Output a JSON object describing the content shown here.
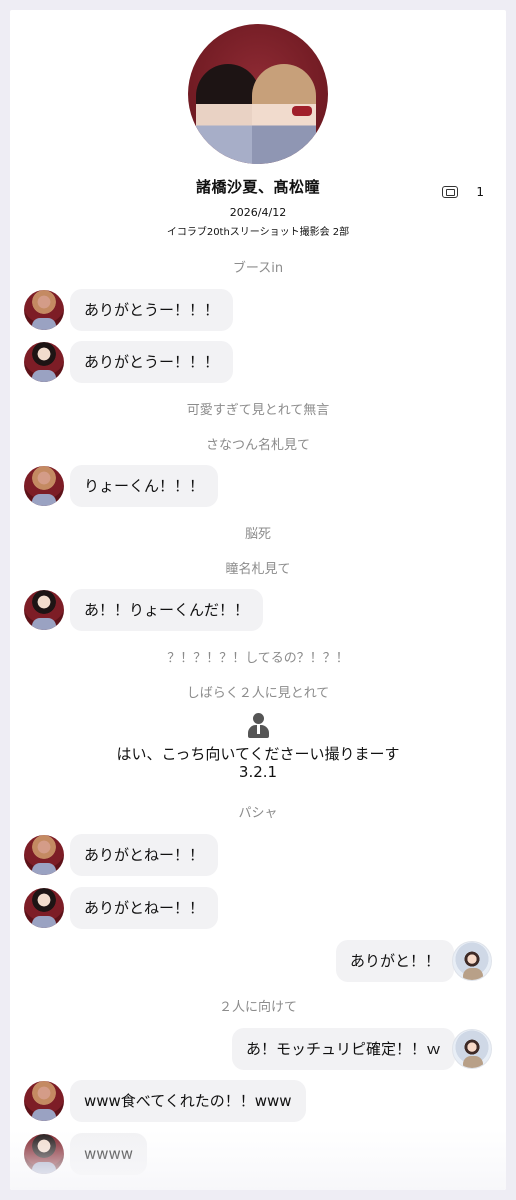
{
  "header": {
    "title": "諸橋沙夏、髙松瞳",
    "copies_count": "1",
    "date": "2026/4/12",
    "event": "イコラブ20thスリーショット撮影会 2部"
  },
  "messages": [
    {
      "kind": "note",
      "text": "ブースin"
    },
    {
      "kind": "left",
      "speaker": "sana",
      "text": "ありがとうー！！！"
    },
    {
      "kind": "left",
      "speaker": "hitomi",
      "text": "ありがとうー！！！"
    },
    {
      "kind": "note",
      "text": "可愛すぎて見とれて無言"
    },
    {
      "kind": "note",
      "text": "さなつん名札見て"
    },
    {
      "kind": "left",
      "speaker": "sana",
      "text": "りょーくん！！！"
    },
    {
      "kind": "note",
      "text": "脳死"
    },
    {
      "kind": "note",
      "text": "瞳名札見て"
    },
    {
      "kind": "left",
      "speaker": "hitomi",
      "text": "あ！！りょーくんだ！！"
    },
    {
      "kind": "note",
      "text": "？！？！？！してるの？！？！"
    },
    {
      "kind": "note",
      "text": "しばらく２人に見とれて"
    },
    {
      "kind": "staff",
      "lines": [
        "はい、こっち向いてくださーい撮りまーす",
        "3.2.1"
      ]
    },
    {
      "kind": "note",
      "text": "パシャ"
    },
    {
      "kind": "left",
      "speaker": "sana",
      "text": "ありがとねー！！"
    },
    {
      "kind": "left",
      "speaker": "hitomi",
      "text": "ありがとねー！！"
    },
    {
      "kind": "right",
      "speaker": "user",
      "text": "ありがと！！"
    },
    {
      "kind": "note",
      "text": "２人に向けて"
    },
    {
      "kind": "right",
      "speaker": "user",
      "text": "あ！モッチュリピ確定！！ｗ"
    },
    {
      "kind": "left",
      "speaker": "sana",
      "text": "www食べてくれたの！！www"
    },
    {
      "kind": "left",
      "speaker": "hitomi",
      "text": "wwww"
    }
  ]
}
